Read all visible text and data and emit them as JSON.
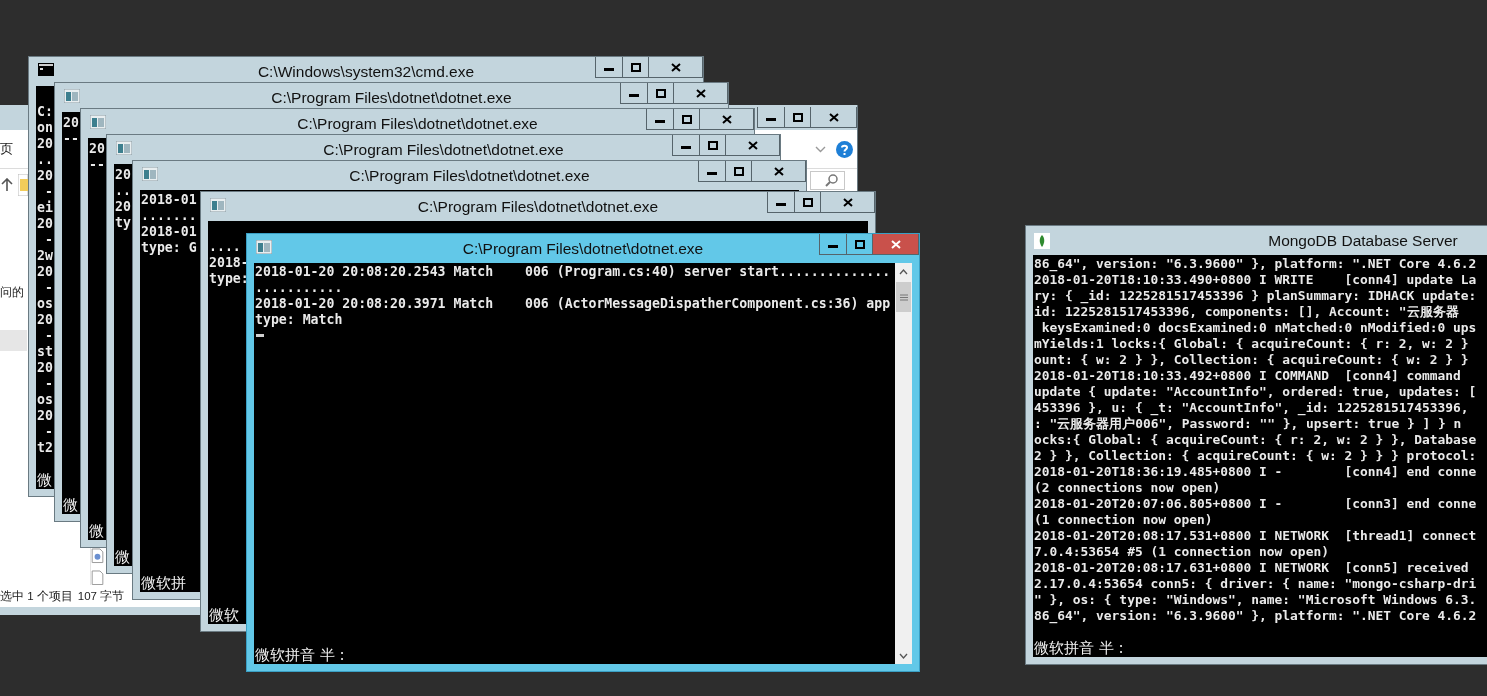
{
  "explorer": {
    "ribbon_tab": "页",
    "nav_item": "问的",
    "status_selection": "选中 1 个项目",
    "status_size": "107 字节"
  },
  "windows": [
    {
      "title": "C:\\Windows\\system32\\cmd.exe",
      "kind": "cmd",
      "selected": false,
      "lines": [
        "C:",
        "on",
        "20",
        "..",
        "20",
        " -",
        "ei",
        "20",
        " -",
        "2w",
        "20",
        " -",
        "os",
        "20",
        " -",
        "st",
        "20",
        " -",
        "os",
        "20",
        " -",
        "t2"
      ],
      "ime": "微"
    },
    {
      "title": "C:\\Program Files\\dotnet\\dotnet.exe",
      "kind": "dotnet",
      "selected": false,
      "lines": [
        "20",
        "--"
      ],
      "ime": "微"
    },
    {
      "title": "C:\\Program Files\\dotnet\\dotnet.exe",
      "kind": "dotnet",
      "selected": false,
      "lines": [
        "20",
        "--"
      ],
      "ime": "微"
    },
    {
      "title": "C:\\Program Files\\dotnet\\dotnet.exe",
      "kind": "dotnet",
      "selected": false,
      "lines": [
        "20",
        "..",
        "20",
        "ty"
      ],
      "ime": "微"
    },
    {
      "title": "C:\\Program Files\\dotnet\\dotnet.exe",
      "kind": "dotnet",
      "selected": false,
      "lines": [
        "2018-01",
        ".......",
        "2018-01",
        "type: G"
      ],
      "ime": "微软拼"
    },
    {
      "title": "C:\\Program Files\\dotnet\\dotnet.exe",
      "kind": "dotnet",
      "selected": false,
      "lines": [
        "....",
        "2018-",
        "type:"
      ],
      "ime": "微软"
    },
    {
      "title": "C:\\Program Files\\dotnet\\dotnet.exe",
      "kind": "dotnet",
      "selected": true,
      "lines": [
        "2018-01-20 20:08:20.2543 Match    006 (Program.cs:40) server start..............",
        "...........",
        "2018-01-20 20:08:20.3971 Match    006 (ActorMessageDispatherComponent.cs:36) app",
        "type: Match"
      ],
      "ime": "微软拼音 半 :"
    }
  ],
  "mongo": {
    "title": "MongoDB Database Server",
    "lines": [
      "86_64\", version: \"6.3.9600\" }, platform: \".NET Core 4.6.2",
      "2018-01-20T18:10:33.490+0800 I WRITE    [conn4] update La",
      "ry: { _id: 1225281517453396 } planSummary: IDHACK update:",
      "id: 1225281517453396, components: [], Account: \"云服务器",
      " keysExamined:0 docsExamined:0 nMatched:0 nModified:0 ups",
      "mYields:1 locks:{ Global: { acquireCount: { r: 2, w: 2 }",
      "ount: { w: 2 } }, Collection: { acquireCount: { w: 2 } }",
      "2018-01-20T18:10:33.492+0800 I COMMAND  [conn4] command",
      "update { update: \"AccountInfo\", ordered: true, updates: [",
      "453396 }, u: { _t: \"AccountInfo\", _id: 1225281517453396,",
      ": \"云服务器用户006\", Password: \"\" }, upsert: true } ] } n",
      "ocks:{ Global: { acquireCount: { r: 2, w: 2 } }, Database",
      "2 } }, Collection: { acquireCount: { w: 2 } } } protocol:",
      "2018-01-20T18:36:19.485+0800 I -        [conn4] end conne",
      "(2 connections now open)",
      "2018-01-20T20:07:06.805+0800 I -        [conn3] end conne",
      "(1 connection now open)",
      "2018-01-20T20:08:17.531+0800 I NETWORK  [thread1] connect",
      "7.0.4:53654 #5 (1 connection now open)",
      "2018-01-20T20:08:17.631+0800 I NETWORK  [conn5] received",
      "2.17.0.4:53654 conn5: { driver: { name: \"mongo-csharp-dri",
      "\" }, os: { type: \"Windows\", name: \"Microsoft Windows 6.3.",
      "86_64\", version: \"6.3.9600\" }, platform: \".NET Core 4.6.2"
    ],
    "ime": "微软拼音 半 :"
  }
}
